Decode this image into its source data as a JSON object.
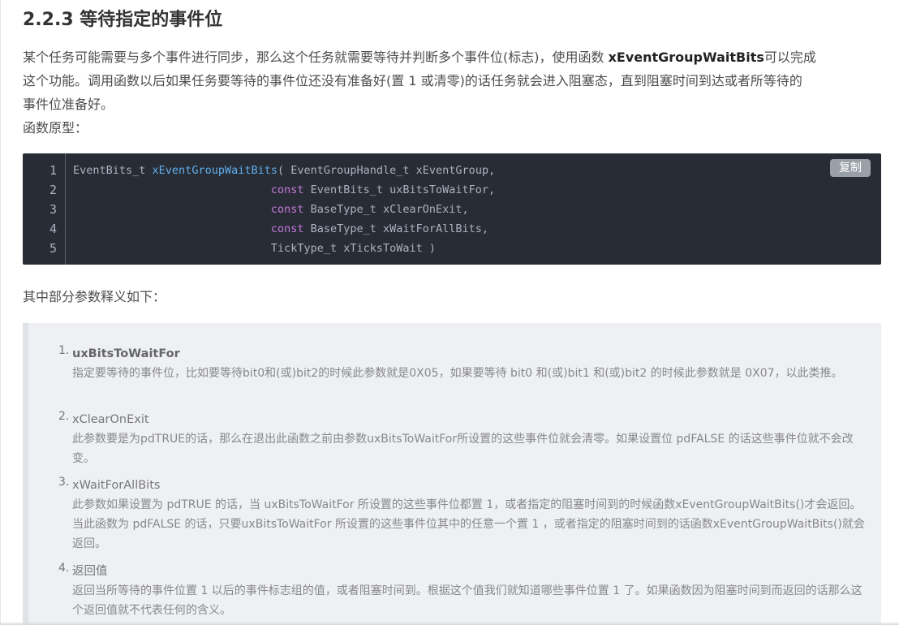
{
  "section": {
    "title": "2.2.3 等待指定的事件位"
  },
  "intro": {
    "line1_pre": "某个任务可能需要与多个事件进行同步，那么这个任务就需要等待并判断多个事件位(标志)，使用函数 ",
    "line1_fn": "xEventGroupWaitBits",
    "line1_post": "可以完成",
    "line2": "这个功能。调用函数以后如果任务要等待的事件位还没有准备好(置 1 或清零)的话任务就会进入阻塞态，直到阻塞时间到达或者所等待的",
    "line3": "事件位准备好。",
    "line4": "函数原型："
  },
  "code": {
    "copy_label": "复制",
    "line_numbers": [
      "1",
      "2",
      "3",
      "4",
      "5"
    ],
    "lines": [
      {
        "pre": "EventBits_t ",
        "fn": "xEventGroupWaitBits",
        "post": "( EventGroupHandle_t xEventGroup,"
      },
      {
        "indent": "                              ",
        "kw": "const",
        "post": " EventBits_t uxBitsToWaitFor,"
      },
      {
        "indent": "                              ",
        "kw": "const",
        "post": " BaseType_t xClearOnExit,"
      },
      {
        "indent": "                              ",
        "kw": "const",
        "post": " BaseType_t xWaitForAllBits,"
      },
      {
        "indent": "                              ",
        "post": "TickType_t xTicksToWait )"
      }
    ]
  },
  "params_intro": "其中部分参数释义如下：",
  "params": [
    {
      "num": "1.",
      "name": "uxBitsToWaitFor",
      "desc": "指定要等待的事件位，比如要等待bit0和(或)bit2的时候此参数就是0X05，如果要等待 bit0 和(或)bit1 和(或)bit2 的时候此参数就是 0X07，以此类推。"
    },
    {
      "num": "2.",
      "name": "xClearOnExit",
      "desc": "此参数要是为pdTRUE的话，那么在退出此函数之前由参数uxBitsToWaitFor所设置的这些事件位就会清零。如果设置位 pdFALSE 的话这些事件位就不会改变。"
    },
    {
      "num": "3.",
      "name": "xWaitForAllBits",
      "desc": "此参数如果设置为 pdTRUE 的话，当 uxBitsToWaitFor 所设置的这些事件位都置 1，或者指定的阻塞时间到的时候函数xEventGroupWaitBits()才会返回。当此函数为 pdFALSE 的话，只要uxBitsToWaitFor 所设置的这些事件位其中的任意一个置 1 ，或者指定的阻塞时间到的话函数xEventGroupWaitBits()就会返回。"
    },
    {
      "num": "4.",
      "name": "返回值",
      "desc": "返回当所等待的事件位置 1 以后的事件标志组的值，或者阻塞时间到。根据这个值我们就知道哪些事件位置 1 了。如果函数因为阻塞时间到而返回的话那么这个返回值就不代表任何的含义。"
    }
  ]
}
